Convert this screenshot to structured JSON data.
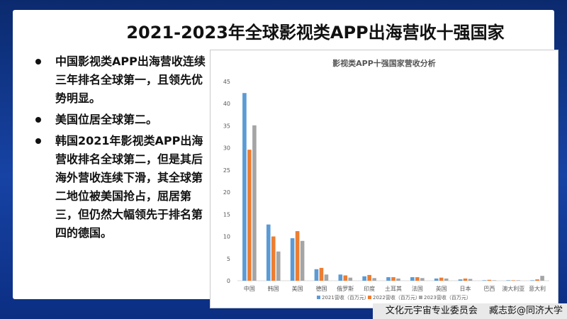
{
  "slide": {
    "title": "2021-2023年全球影视类APP出海营收十强国家",
    "bullets": [
      "中国影视类APP出海营收连续三年排名全球第一，且领先优势明显。",
      "美国位居全球第二。",
      "韩国2021年影视类APP出海营收排名全球第二，但是其后海外营收连续下滑，其全球第二地位被美国抢占，屈居第三，但仍然大幅领先于排名第四的德国。"
    ],
    "footer": {
      "org": "文化元宇宙专业委员会",
      "author": "臧志彭@同济大学"
    }
  },
  "colors": {
    "series_2021": "#5b9bd5",
    "series_2022": "#ed7d31",
    "series_2023": "#a5a5a5"
  },
  "chart_data": {
    "type": "bar",
    "title": "影视类APP十强国家营收分析",
    "categories": [
      "中国",
      "韩国",
      "美国",
      "德国",
      "俄罗斯",
      "印度",
      "土耳其",
      "法国",
      "英国",
      "日本",
      "巴西",
      "澳大利亚",
      "意大利"
    ],
    "series": [
      {
        "name": "2021营收（百万元）",
        "values": [
          42.4,
          12.7,
          9.6,
          2.6,
          1.4,
          1.0,
          0.8,
          0.8,
          0.5,
          0.3,
          0.1,
          0.1,
          0.1
        ]
      },
      {
        "name": "2022营收（百万元）",
        "values": [
          29.6,
          10.0,
          11.2,
          2.9,
          1.2,
          1.3,
          0.8,
          0.8,
          0.7,
          0.5,
          0.2,
          0.1,
          0.3
        ]
      },
      {
        "name": "2023营收（百万元）",
        "values": [
          35.1,
          6.6,
          9.0,
          1.4,
          0.7,
          0.6,
          0.5,
          0.6,
          0.5,
          0.4,
          0.1,
          0.1,
          1.1
        ]
      }
    ],
    "ylim": [
      0,
      45
    ],
    "yticks": [
      0,
      5,
      10,
      15,
      20,
      25,
      30,
      35,
      40,
      45
    ],
    "grid": false,
    "legend": "bottom"
  }
}
